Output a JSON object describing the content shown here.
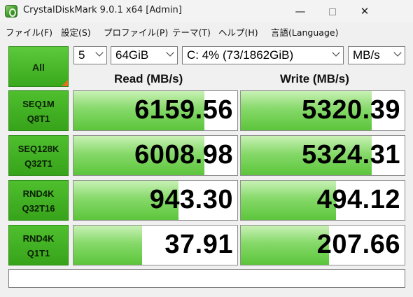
{
  "window": {
    "title": "CrystalDiskMark 9.0.1 x64 [Admin]",
    "min_glyph": "—",
    "close_glyph": "✕"
  },
  "menu": [
    {
      "label": "ファイル(F)"
    },
    {
      "label": "設定(S)"
    },
    {
      "label": "プロファイル(P)"
    },
    {
      "label": "テーマ(T)"
    },
    {
      "label": "ヘルプ(H)"
    },
    {
      "label": "言語(Language)"
    }
  ],
  "controls": {
    "all_label": "All",
    "count": "5",
    "size": "64GiB",
    "drive": "C: 4% (73/1862GiB)",
    "unit": "MB/s"
  },
  "headers": {
    "read": "Read (MB/s)",
    "write": "Write (MB/s)"
  },
  "tests": [
    {
      "line1": "SEQ1M",
      "line2": "Q8T1",
      "read": "6159.56",
      "write": "5320.39",
      "read_fill": 0.8,
      "write_fill": 0.8
    },
    {
      "line1": "SEQ128K",
      "line2": "Q32T1",
      "read": "6008.98",
      "write": "5324.31",
      "read_fill": 0.8,
      "write_fill": 0.8
    },
    {
      "line1": "RND4K",
      "line2": "Q32T16",
      "read": "943.30",
      "write": "494.12",
      "read_fill": 0.64,
      "write_fill": 0.58
    },
    {
      "line1": "RND4K",
      "line2": "Q1T1",
      "read": "37.91",
      "write": "207.66",
      "read_fill": 0.42,
      "write_fill": 0.54
    }
  ],
  "colors": {
    "accent_green": "#3aa81c",
    "bar_green": "#86d96a",
    "corner_orange": "#e8701a"
  }
}
